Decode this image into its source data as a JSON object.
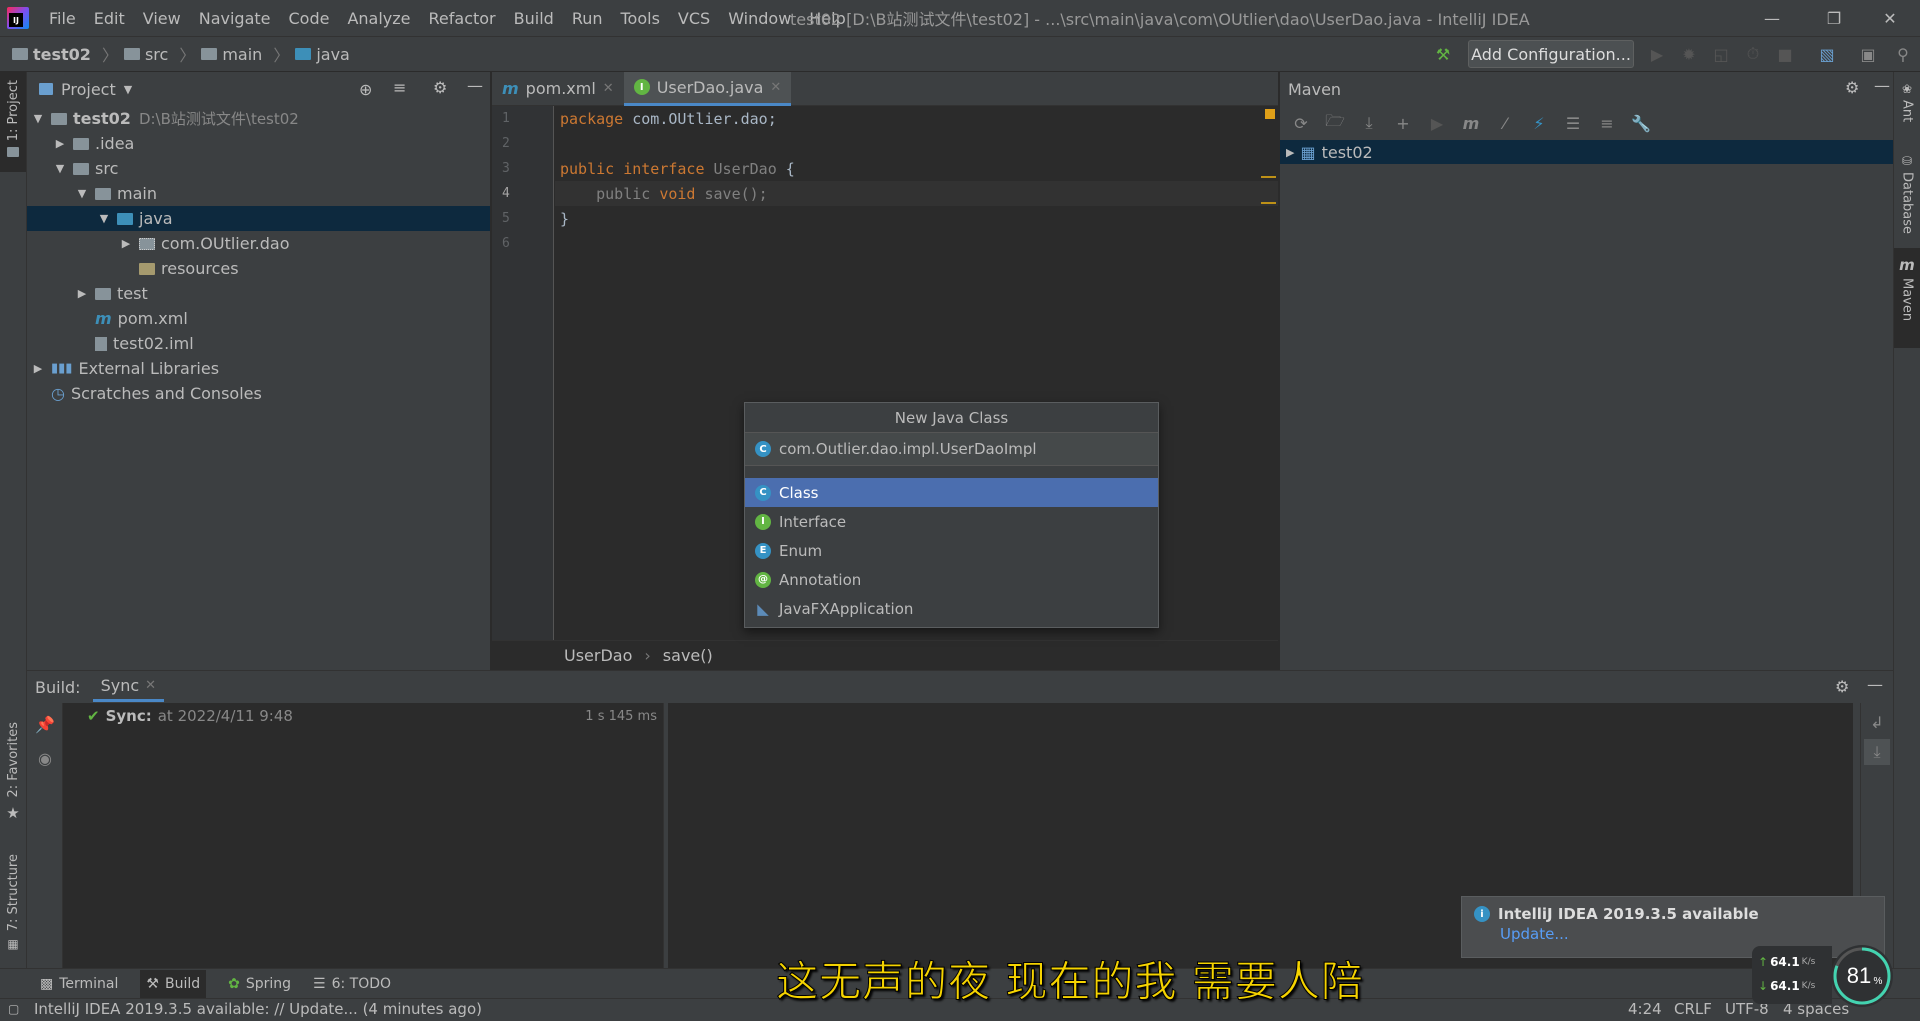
{
  "app": {
    "logo_text": "IJ",
    "menu": [
      "File",
      "Edit",
      "View",
      "Navigate",
      "Code",
      "Analyze",
      "Refactor",
      "Build",
      "Run",
      "Tools",
      "VCS",
      "Window",
      "Help"
    ],
    "window_title": "test02 [D:\\B站测试文件\\test02] - ...\\src\\main\\java\\com\\OUtlier\\dao\\UserDao.java - IntelliJ IDEA"
  },
  "navbar": {
    "crumbs": [
      "test02",
      "src",
      "main",
      "java"
    ],
    "add_config_label": "Add Configuration..."
  },
  "left_strip": {
    "project_tab": "1: Project",
    "favorites_tab": "2: Favorites",
    "structure_tab": "7: Structure"
  },
  "right_strip": {
    "ant_tab": "Ant",
    "database_tab": "Database",
    "maven_tab": "Maven"
  },
  "project": {
    "title": "Project",
    "tree": [
      {
        "label": "test02",
        "extra": "D:\\B站测试文件\\test02"
      },
      {
        "label": ".idea"
      },
      {
        "label": "src"
      },
      {
        "label": "main"
      },
      {
        "label": "java"
      },
      {
        "label": "com.OUtlier.dao"
      },
      {
        "label": "resources"
      },
      {
        "label": "test"
      },
      {
        "label": "pom.xml"
      },
      {
        "label": "test02.iml"
      },
      {
        "label": "External Libraries"
      },
      {
        "label": "Scratches and Consoles"
      }
    ]
  },
  "editor": {
    "tabs": [
      {
        "label": "pom.xml"
      },
      {
        "label": "UserDao.java"
      }
    ],
    "line_numbers": [
      "1",
      "2",
      "3",
      "4",
      "5",
      "6"
    ],
    "code": {
      "l1_kw": "package",
      "l1_rest": " com.OUtlier.dao;",
      "l3_kw1": "public",
      "l3_kw2": "interface",
      "l3_name": "UserDao",
      "l3_rest": " {",
      "l4_kw1": "public",
      "l4_kw2": "void",
      "l4_rest": "save();",
      "l5": "}"
    },
    "breadcrumb": [
      "UserDao",
      "save()"
    ]
  },
  "maven": {
    "title": "Maven",
    "project": "test02"
  },
  "popup": {
    "title": "New Java Class",
    "input_value": "com.Outlier.dao.impl.UserDaoImpl",
    "items": [
      {
        "label": "Class",
        "badge": "C",
        "color": "#3592c4"
      },
      {
        "label": "Interface",
        "badge": "I",
        "color": "#62b543"
      },
      {
        "label": "Enum",
        "badge": "E",
        "color": "#3592c4"
      },
      {
        "label": "Annotation",
        "badge": "@",
        "color": "#62b543"
      },
      {
        "label": "JavaFXApplication",
        "badge": "",
        "color": "#5c8bb8"
      }
    ]
  },
  "build": {
    "label": "Build:",
    "tab": "Sync",
    "sync_label": "Sync:",
    "sync_time": "at 2022/4/11 9:48",
    "duration": "1 s 145 ms"
  },
  "bottom_tabs": [
    "Terminal",
    "Build",
    "Spring",
    "6: TODO"
  ],
  "status": {
    "message": "IntelliJ IDEA 2019.3.5 available: // Update... (4 minutes ago)",
    "position": "4:24",
    "line_sep": "CRLF",
    "encoding": "UTF-8",
    "indent": "4 spaces"
  },
  "notification": {
    "title": "IntelliJ IDEA 2019.3.5 available",
    "link": "Update..."
  },
  "subtitle": "这无声的夜 现在的我 需要人陪",
  "speed_widget": {
    "up": "64.1",
    "down": "64.1",
    "unit": "K/s",
    "percent": "81",
    "percent_sign": "%",
    "fraction": 0.81
  }
}
